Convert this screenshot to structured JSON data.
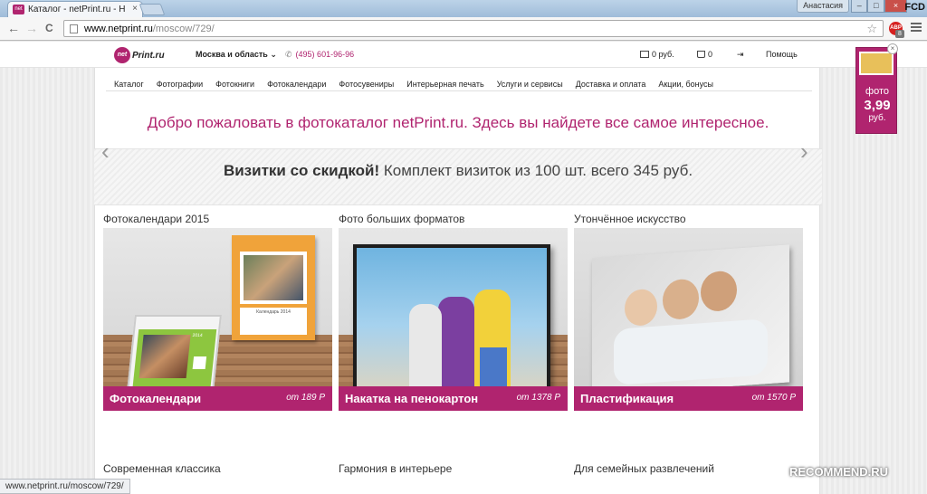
{
  "browser": {
    "tab_title": "Каталог - netPrint.ru - Н",
    "tab_favicon": "net",
    "tab_close": "×",
    "user_name": "Анастасия",
    "window_minimize": "–",
    "window_maximize": "□",
    "window_close": "×",
    "badge_corner": "FCD",
    "url_host": "www.netprint.ru",
    "url_path": "/moscow/729/",
    "back_icon": "←",
    "forward_icon": "→",
    "reload_icon": "C",
    "star_icon": "☆",
    "abp_label": "ABP",
    "abp_count": "8",
    "status_url": "www.netprint.ru/moscow/729/"
  },
  "header": {
    "logo_mark": "net",
    "logo_text": "Print.ru",
    "region": "Москва и область ⌄",
    "phone_icon": "✆",
    "phone": "(495) 601-96-96",
    "cart_value": "0 руб.",
    "basket_value": "0",
    "login_icon": "⇥",
    "help": "Помощь"
  },
  "nav": {
    "items": [
      "Каталог",
      "Фотографии",
      "Фотокниги",
      "Фотокалендари",
      "Фотосувениры",
      "Интерьерная печать",
      "Услуги и сервисы",
      "Доставка и оплата",
      "Акции, бонусы"
    ]
  },
  "welcome": "Добро пожаловать в фотокаталог netPrint.ru. Здесь вы найдете все самое интересное.",
  "promo": {
    "bold": "Визитки со скидкой!",
    "rest": " Комплект визиток из 100 шт. всего 345 руб.",
    "prev": "‹",
    "next": "›"
  },
  "cards": [
    {
      "title": "Фотокалендари 2015",
      "name": "Фотокалендари",
      "price": "от 189 Р",
      "calendar_label": "Календарь 2014",
      "desk_year": "2014"
    },
    {
      "title": "Фото больших форматов",
      "name": "Накатка на пенокартон",
      "price": "от 1378 Р"
    },
    {
      "title": "Утончённое искусство",
      "name": "Пластификация",
      "price": "от 1570 Р"
    }
  ],
  "row2": [
    "Современная классика",
    "Гармония в интерьере",
    "Для семейных развлечений"
  ],
  "side_promo": {
    "l1": "фото",
    "l2": "3,99",
    "l3": "руб.",
    "close": "×"
  },
  "watermark": "RECOMMEND.RU",
  "colors": {
    "brand": "#b0246f"
  }
}
